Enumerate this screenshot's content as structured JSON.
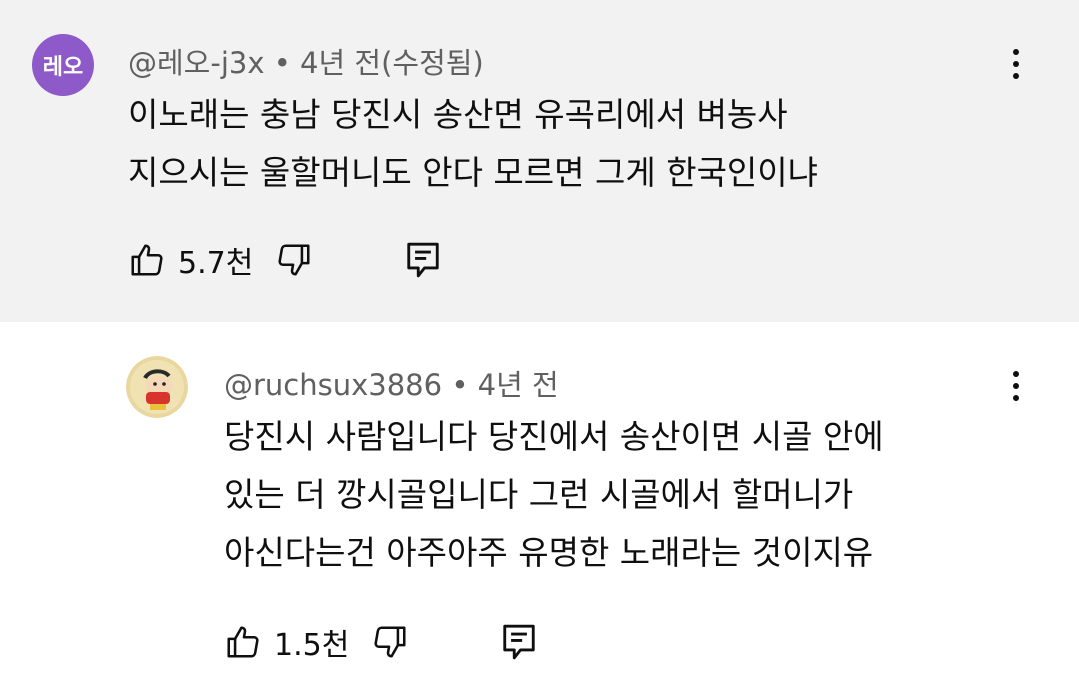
{
  "comments": [
    {
      "avatar_text": "레오",
      "author": "@레오-j3x",
      "time": "4년 전(수정됨)",
      "lines": [
        "이노래는 충남 당진시 송산면 유곡리에서 벼농사",
        "지으시는 울할머니도 안다 모르면 그게 한국인이냐"
      ],
      "likes": "5.7천"
    },
    {
      "author": "@ruchsux3886",
      "time": "4년 전",
      "lines": [
        "당진시 사람입니다 당진에서 송산이면 시골 안에",
        "있는 더 깡시골입니다 그런 시골에서 할머니가",
        "아신다는건 아주아주 유명한 노래라는 것이지유"
      ],
      "likes": "1.5천"
    }
  ],
  "separator": "•",
  "colors": {
    "top_bg": "#f2f2f2",
    "avatar_purple": "#8e59c9",
    "meta_text": "#606060"
  },
  "icons": [
    "thumbs-up-icon",
    "thumbs-down-icon",
    "reply-icon",
    "more-vert-icon"
  ]
}
